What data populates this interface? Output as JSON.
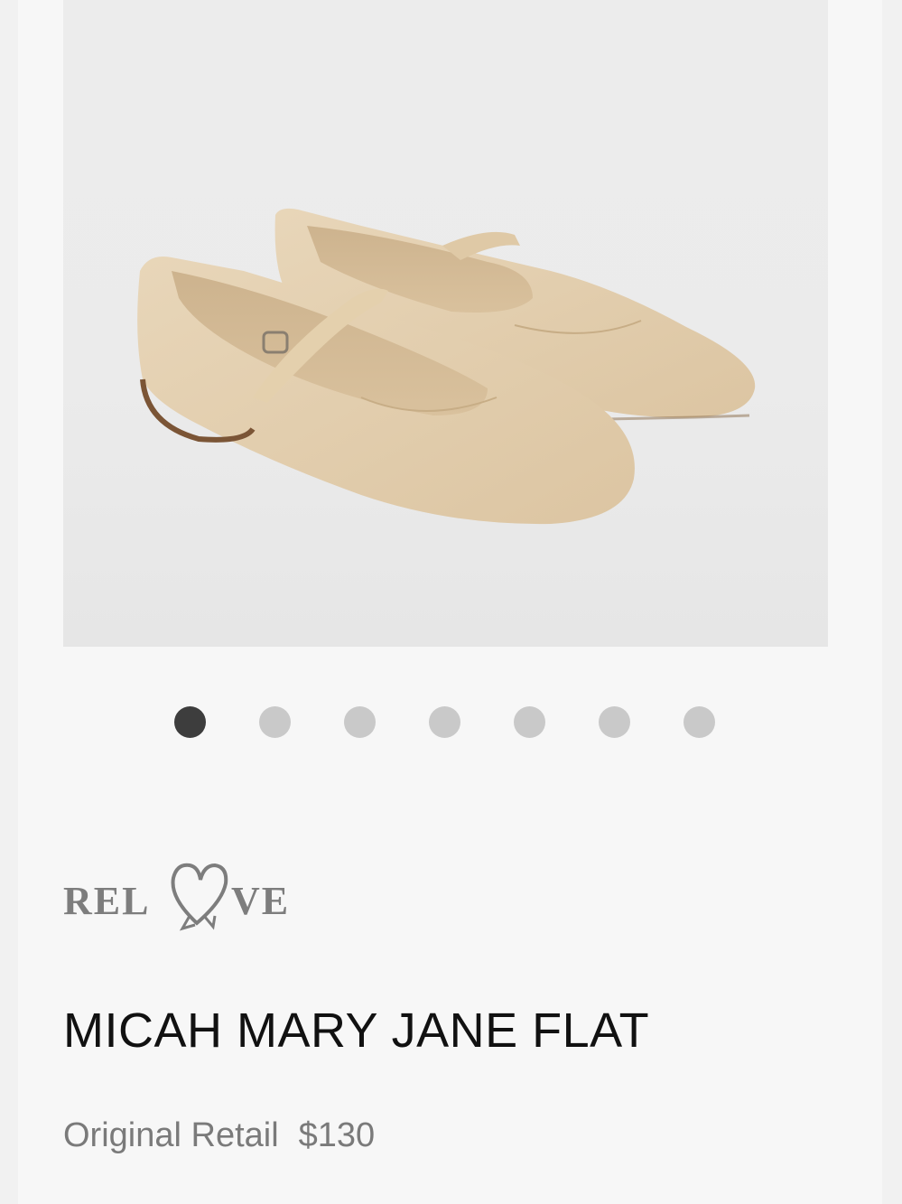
{
  "gallery": {
    "slide_count": 7,
    "active_index": 0
  },
  "brand": {
    "logo_text": "RELOVE"
  },
  "product": {
    "title": "MICAH MARY JANE FLAT",
    "retail_label": "Original Retail",
    "retail_price": "$130"
  }
}
